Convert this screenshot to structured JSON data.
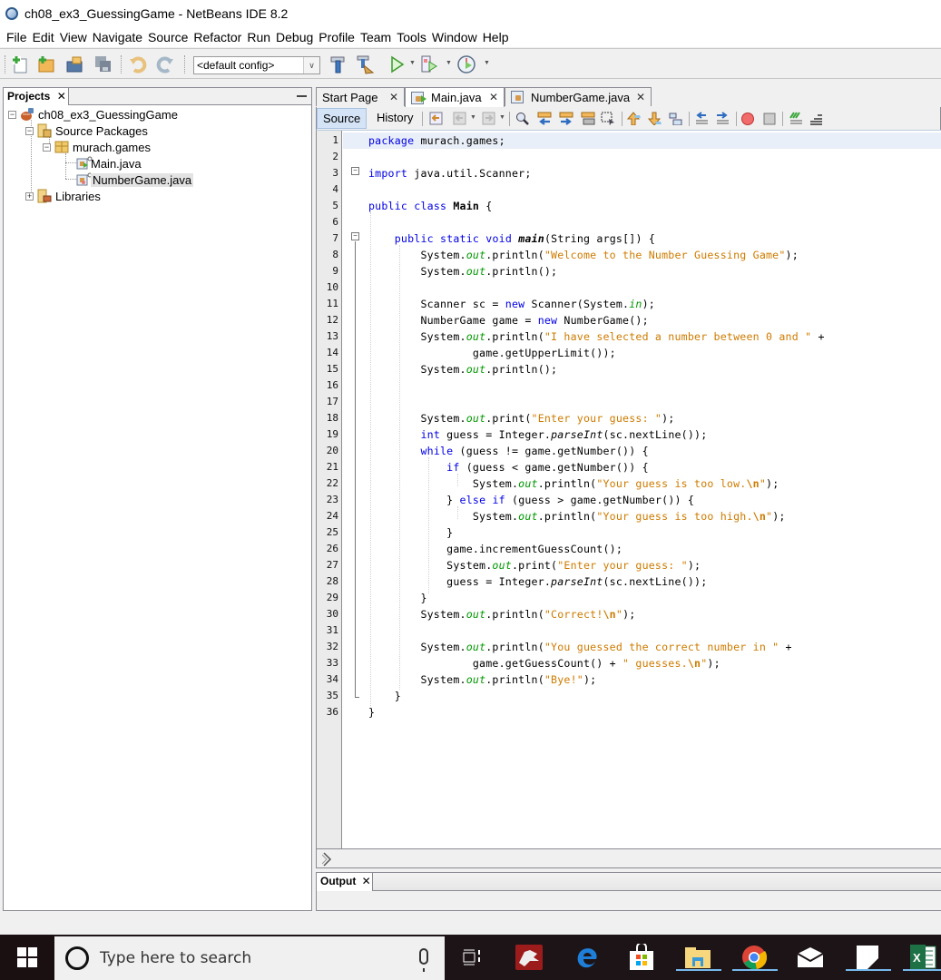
{
  "window": {
    "title": "ch08_ex3_GuessingGame - NetBeans IDE 8.2"
  },
  "menu": [
    "File",
    "Edit",
    "View",
    "Navigate",
    "Source",
    "Refactor",
    "Run",
    "Debug",
    "Profile",
    "Team",
    "Tools",
    "Window",
    "Help"
  ],
  "toolbar": {
    "config_value": "<default config>",
    "icons": [
      "new-file-icon",
      "new-project-icon",
      "open-project-icon",
      "save-all-icon",
      "undo-icon",
      "redo-icon",
      "build-icon",
      "clean-build-icon",
      "run-icon",
      "debug-icon",
      "profile-icon"
    ]
  },
  "projects_panel": {
    "tab_label": "Projects",
    "close_glyph": "✕",
    "tree": [
      {
        "label": "ch08_ex3_GuessingGame",
        "level": 0,
        "expander": "−",
        "icon": "java-project-icon"
      },
      {
        "label": "Source Packages",
        "level": 1,
        "expander": "−",
        "icon": "source-packages-icon"
      },
      {
        "label": "murach.games",
        "level": 2,
        "expander": "−",
        "icon": "package-icon"
      },
      {
        "label": "Main.java",
        "level": 3,
        "icon": "java-main-file-icon"
      },
      {
        "label": "NumberGame.java",
        "level": 3,
        "icon": "java-file-icon",
        "selected": true
      },
      {
        "label": "Libraries",
        "level": 1,
        "expander": "+",
        "icon": "libraries-icon"
      }
    ]
  },
  "editor": {
    "tabs": [
      {
        "label": "Start Page",
        "active": false
      },
      {
        "label": "Main.java",
        "active": true
      },
      {
        "label": "NumberGame.java",
        "active": false
      }
    ],
    "view_tabs": {
      "source": "Source",
      "history": "History"
    },
    "current_line": 1,
    "lines": [
      "package murach.games;",
      "",
      "import java.util.Scanner;",
      "",
      "public class Main {",
      "",
      "    public static void main(String args[]) {",
      "        System.out.println(\"Welcome to the Number Guessing Game\");",
      "        System.out.println();",
      "",
      "        Scanner sc = new Scanner(System.in);",
      "        NumberGame game = new NumberGame();",
      "        System.out.println(\"I have selected a number between 0 and \" +",
      "                game.getUpperLimit());",
      "        System.out.println();",
      "",
      "",
      "        System.out.print(\"Enter your guess: \");",
      "        int guess = Integer.parseInt(sc.nextLine());",
      "        while (guess != game.getNumber()) {",
      "            if (guess < game.getNumber()) {",
      "                System.out.println(\"Your guess is too low.\\n\");",
      "            } else if (guess > game.getNumber()) {",
      "                System.out.println(\"Your guess is too high.\\n\");",
      "            }",
      "            game.incrementGuessCount();",
      "            System.out.print(\"Enter your guess: \");",
      "            guess = Integer.parseInt(sc.nextLine());",
      "        }",
      "        System.out.println(\"Correct!\\n\");",
      "",
      "        System.out.println(\"You guessed the correct number in \" +",
      "                game.getGuessCount() + \" guesses.\\n\");",
      "        System.out.println(\"Bye!\");",
      "    }",
      "}"
    ],
    "fold_markers": [
      3,
      7
    ]
  },
  "output_panel": {
    "tab_label": "Output",
    "close_glyph": "✕"
  },
  "taskbar": {
    "search_placeholder": "Type here to search",
    "apps": [
      "task-view-icon",
      "game-app-icon",
      "edge-icon",
      "store-icon",
      "file-explorer-icon",
      "chrome-icon",
      "mail-icon",
      "sticky-notes-icon",
      "excel-icon"
    ]
  },
  "colors": {
    "keyword": "#0000e6",
    "string": "#ce7b00",
    "field": "#009900",
    "current_line": "#e9eff8",
    "taskbar": "#1d1417"
  }
}
